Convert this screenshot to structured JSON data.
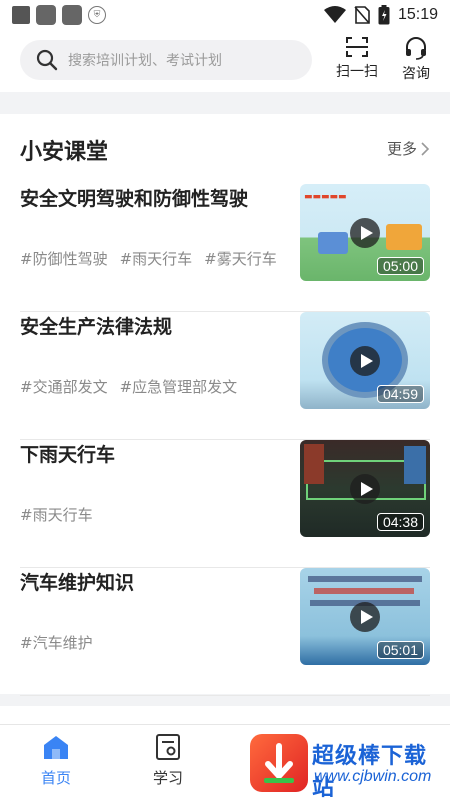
{
  "status_bar": {
    "time": "15:19"
  },
  "header": {
    "search_placeholder": "搜索培训计划、考试计划",
    "scan_label": "扫一扫",
    "consult_label": "咨询"
  },
  "section": {
    "title": "小安课堂",
    "more_label": "更多"
  },
  "courses": [
    {
      "title": "安全文明驾驶和防御性驾驶",
      "tags": [
        "#防御性驾驶",
        "#雨天行车",
        "#雾天行车"
      ],
      "duration": "05:00"
    },
    {
      "title": "安全生产法律法规",
      "tags": [
        "#交通部发文",
        "#应急管理部发文"
      ],
      "duration": "04:59"
    },
    {
      "title": "下雨天行车",
      "tags": [
        "#雨天行车"
      ],
      "duration": "04:38"
    },
    {
      "title": "汽车维护知识",
      "tags": [
        "#汽车维护"
      ],
      "duration": "05:01"
    }
  ],
  "tabs": [
    {
      "label": "首页",
      "icon": "home-icon",
      "active": true
    },
    {
      "label": "学习",
      "icon": "study-icon",
      "active": false
    }
  ],
  "watermark": {
    "title": "超级棒下载站",
    "url": "www.cjbwin.com"
  },
  "colors": {
    "accent": "#3a84f4"
  }
}
